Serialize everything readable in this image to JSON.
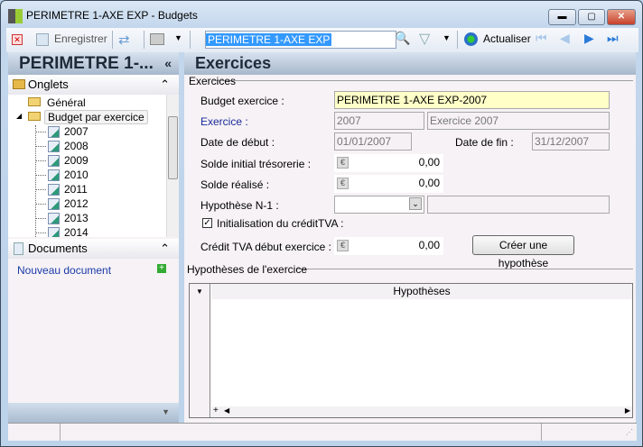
{
  "window": {
    "title": "PERIMETRE 1-AXE EXP -  Budgets",
    "minimize": "▬",
    "maximize": "▢",
    "close": "✕"
  },
  "toolbar": {
    "save_label": "Enregistrer",
    "search_value": "PERIMETRE 1-AXE EXP",
    "refresh_label": "Actualiser"
  },
  "left": {
    "header": "PERIMETRE 1-...",
    "collapse": "«",
    "onglets": "Onglets",
    "tree": {
      "general": "Général",
      "budget": "Budget par exercice",
      "years": [
        "2007",
        "2008",
        "2009",
        "2010",
        "2011",
        "2012",
        "2013",
        "2014"
      ]
    },
    "documents": "Documents",
    "new_doc": "Nouveau document"
  },
  "main": {
    "header": "Exercices",
    "group1": "Exercices",
    "budget_label": "Budget exercice :",
    "budget_value": "PERIMETRE 1-AXE EXP-2007",
    "exercice_label": "Exercice :",
    "exercice_code": "2007",
    "exercice_name": "Exercice 2007",
    "date_debut_label": "Date de début :",
    "date_debut": "01/01/2007",
    "date_fin_label": "Date de fin :",
    "date_fin": "31/12/2007",
    "solde_init_label": "Solde initial trésorerie :",
    "solde_init": "0,00",
    "solde_real_label": "Solde réalisé :",
    "solde_real": "0,00",
    "hyp_label": "Hypothèse N-1 :",
    "hyp_value": "",
    "init_tva_label": "Initialisation du créditTVA :",
    "init_tva_checked": true,
    "credit_label": "Crédit TVA début exercice :",
    "credit_value": "0,00",
    "create_btn": "Créer une hypothèse",
    "group2": "Hypothèses de l'exercice",
    "grid_col": "Hypothèses"
  }
}
